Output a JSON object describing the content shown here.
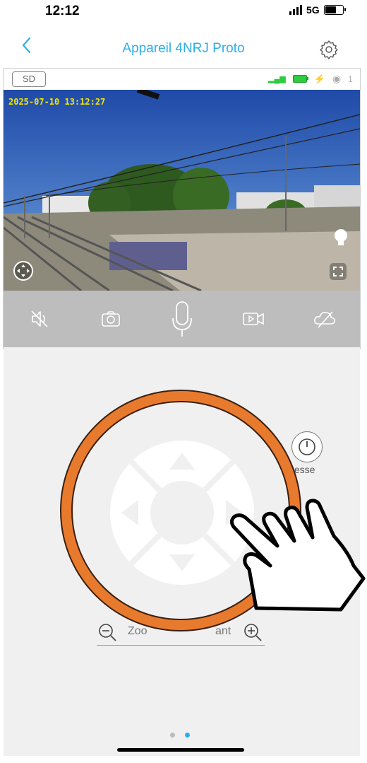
{
  "status_bar": {
    "time": "12:12",
    "network": "5G"
  },
  "nav": {
    "back_icon": "chevron-left-icon",
    "title": "Appareil 4NRJ Proto",
    "settings_icon": "gear-icon"
  },
  "video_panel": {
    "sd_label": "SD",
    "viewer_count": "1",
    "timestamp": "2025-07-10 13:12:27",
    "battery_color": "#2ecc40"
  },
  "controls": [
    {
      "name": "mute",
      "icon": "speaker-mute-icon"
    },
    {
      "name": "snapshot",
      "icon": "camera-icon"
    },
    {
      "name": "talk",
      "icon": "microphone-icon"
    },
    {
      "name": "record",
      "icon": "video-record-icon"
    },
    {
      "name": "cloud",
      "icon": "cloud-off-icon"
    }
  ],
  "ptz": {
    "speed_label": "tesse",
    "zoom_label_left": "Zoo",
    "zoom_label_right": "ant"
  },
  "pager": {
    "count": 2,
    "active": 1
  },
  "colors": {
    "accent": "#2eaee8",
    "highlight_ring": "#e87a2e",
    "control_bar": "#bdbdbd"
  }
}
